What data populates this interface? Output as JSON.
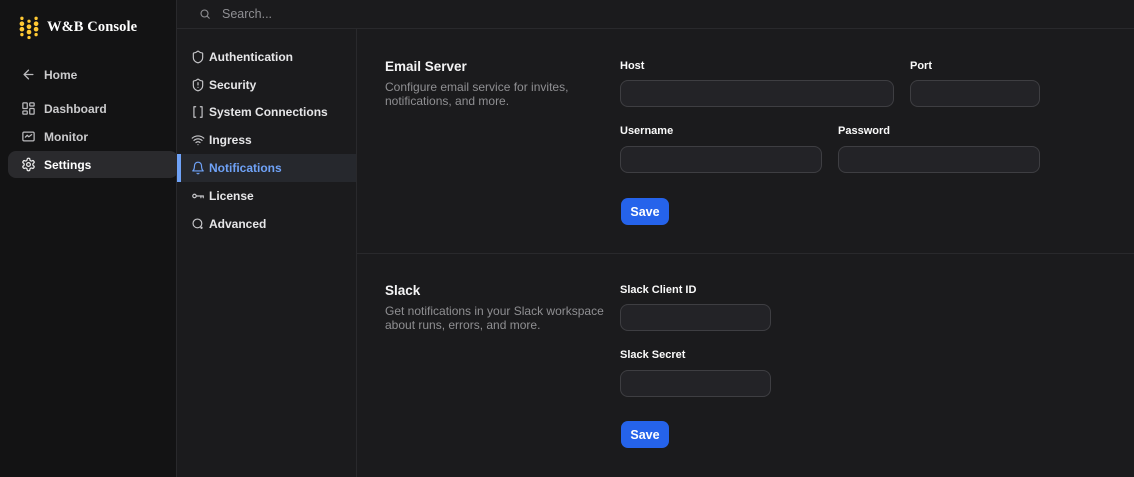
{
  "brand": {
    "title": "W&B Console"
  },
  "colors": {
    "logo_gold": "#ffc933",
    "accent_blue": "#2563eb",
    "nav_active_blue": "#6fa2f7"
  },
  "sidebar": {
    "items": [
      {
        "label": "Home",
        "icon": "arrow-left"
      },
      {
        "label": "Dashboard",
        "icon": "layout-grid"
      },
      {
        "label": "Monitor",
        "icon": "monitor-chart"
      },
      {
        "label": "Settings",
        "icon": "gear",
        "selected": true
      }
    ]
  },
  "topbar": {
    "search_placeholder": "Search..."
  },
  "settings_nav": {
    "items": [
      {
        "label": "Authentication",
        "icon": "shield"
      },
      {
        "label": "Security",
        "icon": "shield-alert"
      },
      {
        "label": "System Connections",
        "icon": "brackets"
      },
      {
        "label": "Ingress",
        "icon": "wifi"
      },
      {
        "label": "Notifications",
        "icon": "bell",
        "selected": true
      },
      {
        "label": "License",
        "icon": "key"
      },
      {
        "label": "Advanced",
        "icon": "circle-dot"
      }
    ]
  },
  "sections": [
    {
      "title": "Email Server",
      "description": "Configure email service for invites, notifications, and more.",
      "fields": [
        {
          "label": "Host",
          "value": ""
        },
        {
          "label": "Port",
          "value": ""
        },
        {
          "label": "Username",
          "value": ""
        },
        {
          "label": "Password",
          "value": ""
        }
      ],
      "save_label": "Save"
    },
    {
      "title": "Slack",
      "description": "Get notifications in your Slack workspace about runs, errors, and more.",
      "fields": [
        {
          "label": "Slack Client ID",
          "value": ""
        },
        {
          "label": "Slack Secret",
          "value": ""
        }
      ],
      "save_label": "Save"
    }
  ]
}
